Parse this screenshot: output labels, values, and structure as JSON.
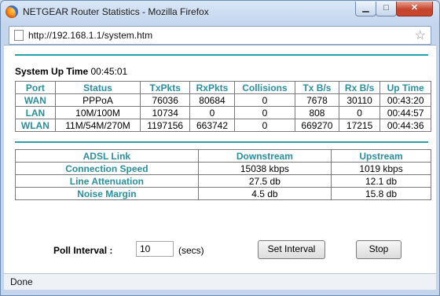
{
  "window": {
    "title": "NETGEAR Router Statistics - Mozilla Firefox",
    "url": "http://192.168.1.1/system.htm",
    "status": "Done"
  },
  "uptime": {
    "label": "System Up Time",
    "value": "00:45:01"
  },
  "stats": {
    "headers": [
      "Port",
      "Status",
      "TxPkts",
      "RxPkts",
      "Collisions",
      "Tx B/s",
      "Rx B/s",
      "Up Time"
    ],
    "rows": [
      [
        "WAN",
        "PPPoA",
        "76036",
        "80684",
        "0",
        "7678",
        "30110",
        "00:43:20"
      ],
      [
        "LAN",
        "10M/100M",
        "10734",
        "0",
        "0",
        "808",
        "0",
        "00:44:57"
      ],
      [
        "WLAN",
        "11M/54M/270M",
        "1197156",
        "663742",
        "0",
        "669270",
        "17215",
        "00:44:36"
      ]
    ]
  },
  "adsl": {
    "headers": [
      "ADSL Link",
      "Downstream",
      "Upstream"
    ],
    "rows": [
      [
        "Connection Speed",
        "15038 kbps",
        "1019 kbps"
      ],
      [
        "Line Attenuation",
        "27.5 db",
        "12.1 db"
      ],
      [
        "Noise Margin",
        "4.5 db",
        "15.8 db"
      ]
    ]
  },
  "poll": {
    "label": "Poll Interval :",
    "value": "10",
    "unit": "(secs)",
    "set_button": "Set Interval",
    "stop_button": "Stop"
  },
  "colors": {
    "accent": "#2a8f9c"
  }
}
